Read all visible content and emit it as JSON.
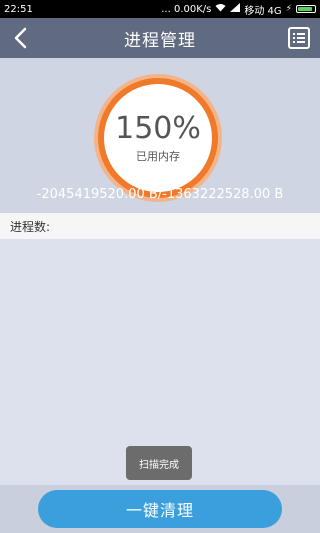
{
  "status_bar": {
    "time": "22:51",
    "network_speed": "... 0.00K/s",
    "carrier": "移动 4G"
  },
  "nav": {
    "title": "进程管理",
    "back_icon": "chevron-left-icon",
    "menu_icon": "list-icon"
  },
  "memory": {
    "percent": "150%",
    "label": "已用内存",
    "values": "-2045419520.00 B/-1363222528.00 B",
    "accent_color": "#f07a2a"
  },
  "process": {
    "header": "进程数:"
  },
  "toast": {
    "message": "扫描完成"
  },
  "actions": {
    "clean_label": "一键清理",
    "clean_color": "#3a9fdc"
  }
}
